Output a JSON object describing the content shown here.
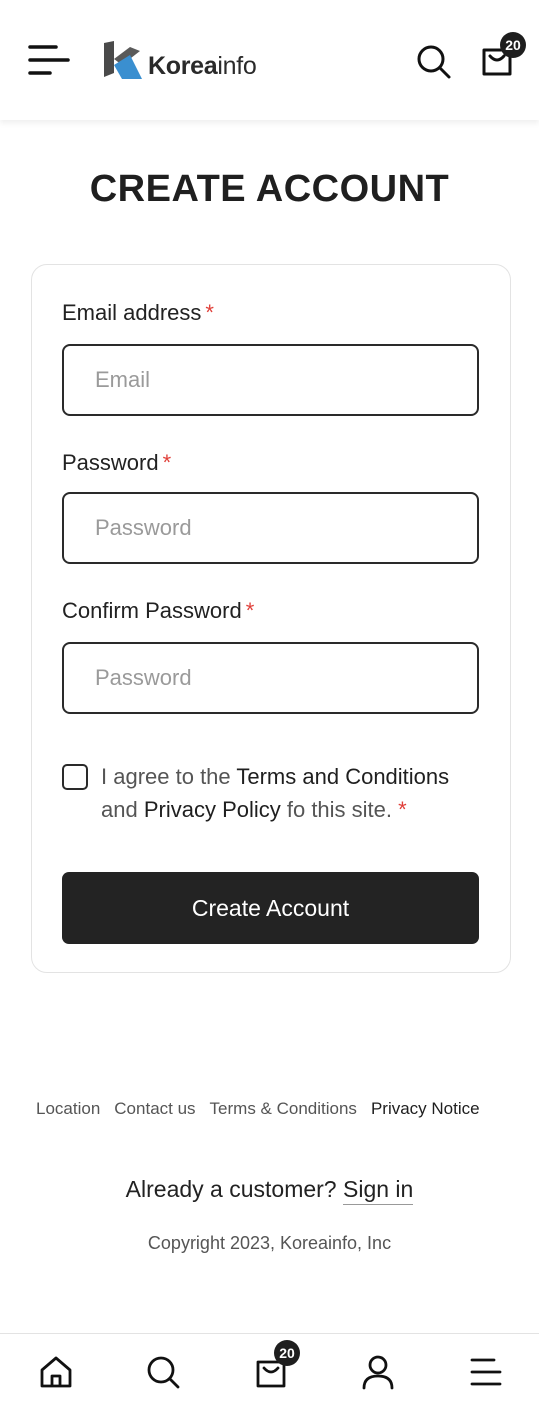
{
  "header": {
    "logo_bold": "Korea",
    "logo_light": "info",
    "cart_count": "20"
  },
  "page_title": "CREATE ACCOUNT",
  "form": {
    "required_mark": "*",
    "email": {
      "label": "Email address",
      "placeholder": "Email",
      "value": ""
    },
    "password": {
      "label": "Password",
      "placeholder": "Password",
      "value": ""
    },
    "confirm": {
      "label": "Confirm Password",
      "placeholder": "Password",
      "value": ""
    },
    "agree": {
      "checked": false,
      "prefix": "I agree to the ",
      "terms_link": "Terms and Conditions",
      "middle": " and ",
      "privacy_link": "Privacy Policy",
      "suffix": " fo this site. "
    },
    "submit_label": "Create Account"
  },
  "footer": {
    "links": [
      "Location",
      "Contact us",
      "Terms & Conditions",
      "Privacy Notice"
    ],
    "already_text": "Already a customer?",
    "signin_label": "Sign in",
    "copyright": "Copyright 2023, Koreainfo, Inc"
  },
  "bottom_nav": {
    "cart_count": "20",
    "items": [
      "home-icon",
      "search-icon",
      "cart-icon",
      "account-icon",
      "menu-icon"
    ]
  },
  "colors": {
    "primary": "#232323",
    "required": "#e0403a",
    "logo_dark": "#4a4a4a",
    "logo_blue": "#3a8fd0"
  }
}
